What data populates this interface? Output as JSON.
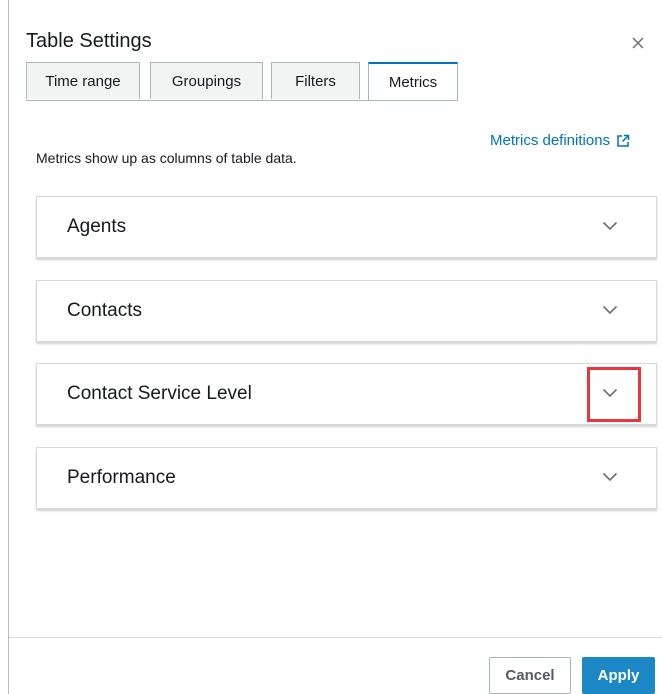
{
  "dialog": {
    "title": "Table Settings"
  },
  "tabs": [
    {
      "label": "Time range",
      "active": false
    },
    {
      "label": "Groupings",
      "active": false
    },
    {
      "label": "Filters",
      "active": false
    },
    {
      "label": "Metrics",
      "active": true
    }
  ],
  "metrics": {
    "definitions_link": "Metrics definitions",
    "description": "Metrics show up as columns of table data.",
    "sections": [
      {
        "label": "Agents",
        "expanded": false
      },
      {
        "label": "Contacts",
        "expanded": false
      },
      {
        "label": "Contact Service Level",
        "expanded": false,
        "highlighted": true
      },
      {
        "label": "Performance",
        "expanded": false
      }
    ]
  },
  "footer": {
    "cancel_label": "Cancel",
    "apply_label": "Apply"
  },
  "colors": {
    "link": "#0073bb",
    "primary_button": "#1b87c4",
    "highlight": "#e8353e"
  },
  "icons": [
    "close-icon",
    "external-link-icon",
    "chevron-down-icon"
  ]
}
